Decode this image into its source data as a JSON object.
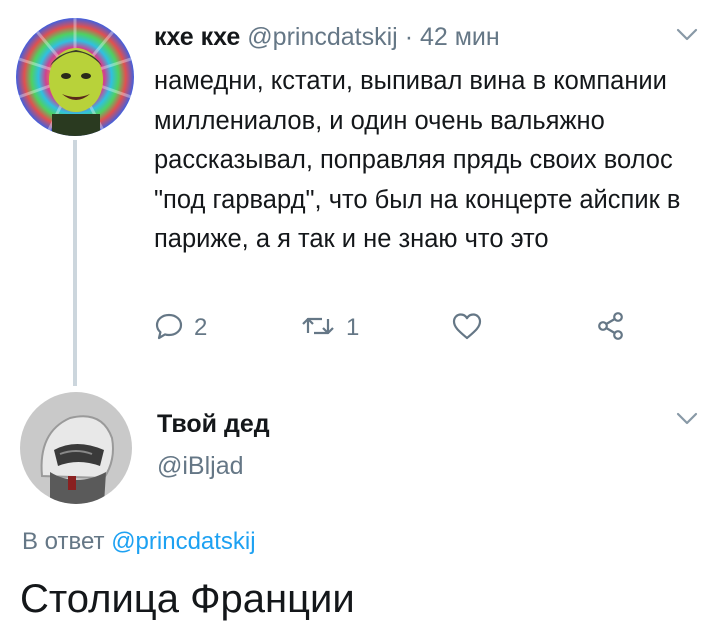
{
  "tweet1": {
    "author_name": "кхе кхе",
    "handle": "@princdatskij",
    "separator": "·",
    "time": "42 мин",
    "text": "намедни, кстати, выпивал вина в компании миллениалов, и один очень вальяжно рассказывал, поправляя прядь своих волос \"под гарвард\", что был на концерте айспик в париже, а я так и не знаю что это",
    "actions": {
      "reply_count": "2",
      "retweet_count": "1"
    }
  },
  "tweet2": {
    "author_name": "Твой дед",
    "handle": "@iBljad",
    "reply_prefix": "В ответ",
    "reply_mention": "@princdatskij",
    "text": "Столица Франции"
  },
  "icons": {
    "menu": "chevron-down-icon",
    "reply": "reply-icon",
    "retweet": "retweet-icon",
    "like": "heart-icon",
    "share": "share-icon"
  },
  "colors": {
    "text": "#14171a",
    "secondary": "#657786",
    "link": "#1da1f2",
    "thread_line": "#ccd6dd"
  }
}
